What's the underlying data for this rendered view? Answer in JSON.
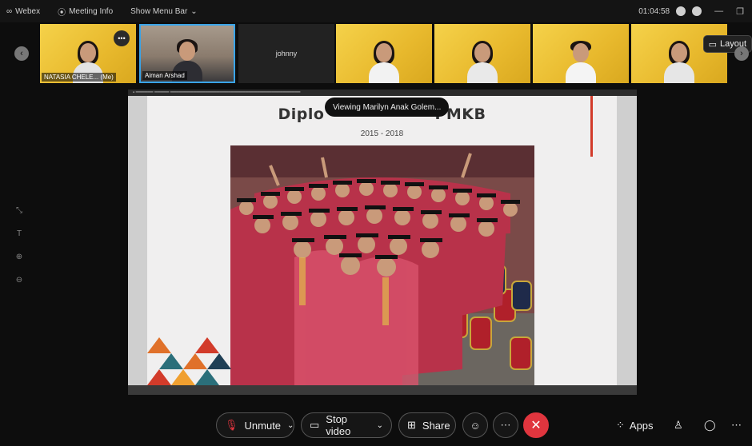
{
  "topbar": {
    "app_name": "Webex",
    "meeting_info": "Meeting Info",
    "menu_bar": "Show Menu Bar",
    "timer": "01:04:58"
  },
  "participants": [
    {
      "name": "NATASIA CHELE...",
      "tag": "(Me)",
      "style": "yellow"
    },
    {
      "name": "Aiman Arshad",
      "style": "office"
    },
    {
      "name": "johnny",
      "style": "dark"
    },
    {
      "name": "",
      "style": "yellow"
    },
    {
      "name": "",
      "style": "yellow"
    },
    {
      "name": "",
      "style": "yellow"
    },
    {
      "name": "",
      "style": "yellow"
    }
  ],
  "layout_button": "Layout",
  "viewing_tip": "Viewing Marilyn Anak Golem...",
  "slide": {
    "title_left": "Diplo",
    "title_right": "PMKB",
    "subtitle": "2015 - 2018"
  },
  "controls": {
    "unmute": "Unmute",
    "stop_video": "Stop video",
    "share": "Share",
    "apps": "Apps"
  },
  "colors": {
    "end_call": "#e0353e",
    "accent_blue": "#3aa4e8",
    "slide_red": "#d23b2a",
    "gown": "#b8324a"
  }
}
